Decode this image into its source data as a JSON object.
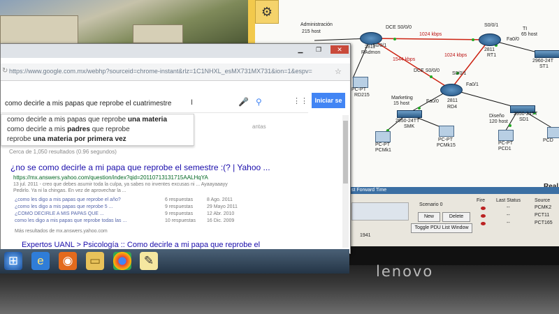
{
  "monitor": {
    "brand": "lenovo"
  },
  "chrome": {
    "url": "https://www.google.com.mx/webhp?sourceid=chrome-instant&rlz=1C1NHXL_esMX731MX731&ion=1&espv=",
    "search": {
      "query": "como decirle a mis papas que reprobe el cuatrimestre",
      "button_label": "Iniciar se"
    },
    "suggestions": [
      {
        "prefix": "como decirle a mis papas que reprobe ",
        "bold": "una materia",
        "suffix": ""
      },
      {
        "prefix": "como decirle a mis ",
        "bold": "padres",
        "suffix": " que reprobe"
      },
      {
        "prefix": "reprobe ",
        "bold": "una materia por primera vez",
        "suffix": ""
      }
    ],
    "results_stats": "Cerca de 1,050 resultados (0.96 segundos)",
    "partial_text": "antas",
    "result1": {
      "title": "¿no se como decirle a mi papa que reprobe el semestre :(? | Yahoo ...",
      "url": "https://mx.answers.yahoo.com/question/index?qid=20110713131715AALHqYA",
      "snippet1": "13 jul. 2011 - creo que debes asumir toda la culpa, ya sabes no inventes excusas ni ... Ayaayaaayy",
      "snippet2": "Pedirlo. Ya ni la chingas. En vez de aprovechar la ...",
      "answers": [
        {
          "q": "¿como les digo a mis papas que reprobe el año?",
          "n": "6 respuestas",
          "d": "8 Ago. 2011"
        },
        {
          "q": "¿como les digo a mis papas que reprobe 5 ...",
          "n": "9 respuestas",
          "d": "29 Mayo 2011"
        },
        {
          "q": "¿COMO DECIRLE A MIS PAPAS QUE ...",
          "n": "9 respuestas",
          "d": "12 Abr. 2010"
        },
        {
          "q": "como les digo a mis papas que reprobe todas las ...",
          "n": "10 respuestas",
          "d": "16 Dic. 2009"
        }
      ],
      "more": "Más resultados de mx.answers.yahoo.com"
    },
    "result2_title": "Expertos UANL > Psicología :: Como decirle a mi papa que reprobe el"
  },
  "packet_tracer": {
    "labels": {
      "admin": "Administración",
      "admin_hosts": "215 host",
      "radmon": "RAdmon",
      "radmon_model": "2811",
      "dce1": "DCE S0/0/0",
      "bw1": "1024 kbps",
      "rt1": "RT1",
      "rt1_model": "2811",
      "rt1_if": "S0/0/1",
      "rt1_fa": "Fa0/0",
      "ti": "TI",
      "ti_hosts": "65 host",
      "st1": "ST1",
      "bw2": "1544 kbps",
      "bw3": "1024 kbps",
      "dce2": "DCE S0/0/0",
      "rd215": "RD215",
      "s001": "S0/0/1",
      "s0011": "S0/0/1",
      "marketing": "Marketing",
      "mk_hosts": "15 host",
      "rd4": "RD4",
      "rd4_model": "2811",
      "fa00": "Fa0/0",
      "fa01": "Fa0/1",
      "smk": "SMK",
      "smk_model": "2950-24TT",
      "diseno": "Diseño",
      "d_hosts": "120 host",
      "sd1": "SD1",
      "sd1_model": "2950-24TT",
      "pcmk1": "PCMk1",
      "pcmk15": "PCMk15",
      "pcd1": "PCD1",
      "pcd": "PCD",
      "pcpt": "PC-PT",
      "real": "Real",
      "sw_st1": "2960-24T"
    },
    "fast_forward": "st Forward Time",
    "scenario": "Scenario 0",
    "new_btn": "New",
    "delete_btn": "Delete",
    "toggle_btn": "Toggle PDU List Window",
    "device_1941": "1941",
    "event_headers": [
      "Fire",
      "Last Status",
      "Source"
    ],
    "events": [
      {
        "status": "--",
        "source": "PCMK2"
      },
      {
        "status": "--",
        "source": "PCT11"
      },
      {
        "status": "--",
        "source": "PCT165"
      }
    ]
  },
  "taskbar": {
    "icons": [
      "windows-start-icon",
      "ie-icon",
      "firefox-icon",
      "folder-icon",
      "chrome-icon",
      "app-icon"
    ]
  }
}
